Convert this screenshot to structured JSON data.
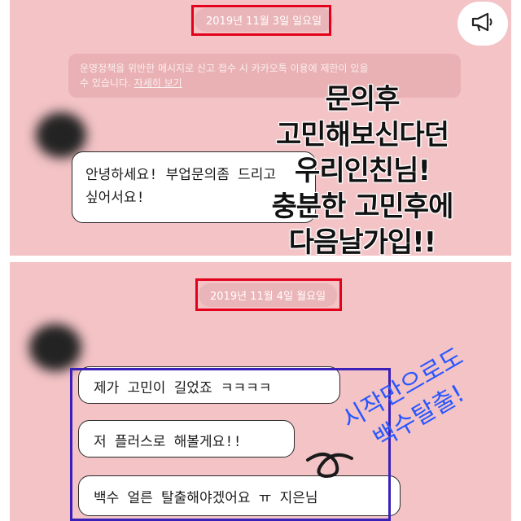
{
  "top_panel": {
    "date": "2019년 11월 3일 일요일",
    "notice_line1": "운영정책을 위반한 메시지로 신고 접수 시 카카오톡 이용에 제한이 있을",
    "notice_line2": "수 있습니다.",
    "notice_link": "자세히 보기",
    "message_line1": "안녕하세요! 부업문의좀 드리고",
    "message_line2": "싶어서요!",
    "icon": "megaphone-icon"
  },
  "bottom_panel": {
    "date": "2019년 11월 4일 월요일",
    "messages": [
      "제가 고민이 길었죠 ㅋㅋㅋㅋ",
      "저 플러스로 해볼게요!!",
      "백수 얼른 탈출해야겠어요 ㅠ 지은님"
    ]
  },
  "overlay_caption": [
    "문의후",
    "고민해보신다던",
    "우리인친님!",
    "충분한 고민후에",
    "다음날가입!!"
  ],
  "blue_annotation": [
    "시작만으로도",
    "백수탈출!"
  ],
  "colors": {
    "chat_bg": "#f3c3c6",
    "highlight_red": "#e3001b",
    "highlight_purple": "#3a20b8",
    "annotation_blue": "#2857ff"
  }
}
